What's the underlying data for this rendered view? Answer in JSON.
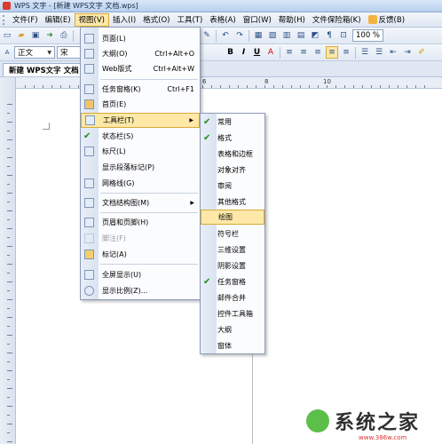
{
  "window": {
    "title": "WPS 文字 - [新建 WPS文字 文档.wps]"
  },
  "menubar": {
    "items": [
      {
        "label": "文件(F)"
      },
      {
        "label": "编辑(E)"
      },
      {
        "label": "视图(V)",
        "active": true
      },
      {
        "label": "插入(I)"
      },
      {
        "label": "格式(O)"
      },
      {
        "label": "工具(T)"
      },
      {
        "label": "表格(A)"
      },
      {
        "label": "窗口(W)"
      },
      {
        "label": "帮助(H)"
      },
      {
        "label": "文件保险箱(K)"
      },
      {
        "label": "反馈(B)"
      }
    ]
  },
  "toolbar": {
    "style_value": "正文",
    "font_value": "宋",
    "zoom_value": "100 %",
    "bold": "B",
    "italic": "I",
    "underline": "U"
  },
  "document_tab": {
    "label": "新建 WPS文字 文档"
  },
  "hruler": {
    "numbers": [
      "6",
      "8",
      "10"
    ]
  },
  "view_menu": {
    "items": [
      {
        "label": "页面(L)",
        "shortcut": ""
      },
      {
        "label": "大纲(O)",
        "shortcut": "Ctrl+Alt+O"
      },
      {
        "label": "Web版式",
        "shortcut": "Ctrl+Alt+W"
      },
      {
        "label": "任务窗格(K)",
        "shortcut": "Ctrl+F1"
      },
      {
        "label": "首页(E)",
        "shortcut": ""
      },
      {
        "label": "工具栏(T)",
        "shortcut": ""
      },
      {
        "label": "状态栏(S)",
        "shortcut": ""
      },
      {
        "label": "标尺(L)",
        "shortcut": ""
      },
      {
        "label": "显示段落标记(P)",
        "shortcut": ""
      },
      {
        "label": "网格线(G)",
        "shortcut": ""
      },
      {
        "label": "文档结构图(M)",
        "shortcut": ""
      },
      {
        "label": "页眉和页脚(H)",
        "shortcut": ""
      },
      {
        "label": "脚注(F)",
        "shortcut": ""
      },
      {
        "label": "标记(A)",
        "shortcut": ""
      },
      {
        "label": "全屏显示(U)",
        "shortcut": ""
      },
      {
        "label": "显示比例(Z)...",
        "shortcut": ""
      }
    ]
  },
  "toolbars_submenu": {
    "items": [
      {
        "label": "常用",
        "checked": true
      },
      {
        "label": "格式",
        "checked": true
      },
      {
        "label": "表格和边框",
        "checked": false
      },
      {
        "label": "对象对齐",
        "checked": false
      },
      {
        "label": "审阅",
        "checked": false
      },
      {
        "label": "其他格式",
        "checked": false
      },
      {
        "label": "绘图",
        "checked": false
      },
      {
        "label": "符号栏",
        "checked": false
      },
      {
        "label": "三维设置",
        "checked": false
      },
      {
        "label": "阴影设置",
        "checked": false
      },
      {
        "label": "任务窗格",
        "checked": true
      },
      {
        "label": "邮件合并",
        "checked": false
      },
      {
        "label": "控件工具箱",
        "checked": false
      },
      {
        "label": "大纲",
        "checked": false
      },
      {
        "label": "窗体",
        "checked": false
      }
    ]
  },
  "watermark": {
    "text": "系统之家",
    "url": "www.386w.com"
  }
}
